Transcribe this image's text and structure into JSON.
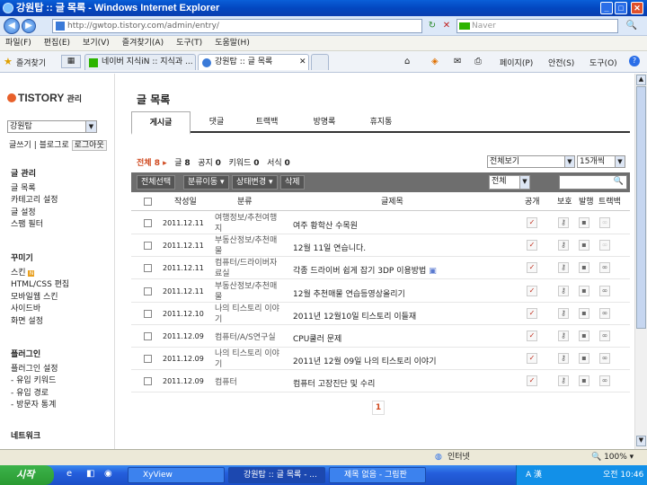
{
  "window": {
    "title": "강원탑 :: 글 목록 - Windows Internet Explorer",
    "min": "_",
    "max": "□",
    "close": "✕"
  },
  "address": {
    "url": "http://gwtop.tistory.com/admin/entry/",
    "search_placeholder": "Naver",
    "back": "◀",
    "forward": "▶",
    "refresh": "↻",
    "stop": "✕",
    "search_btn": "🔍"
  },
  "menu": [
    "파일(F)",
    "편집(E)",
    "보기(V)",
    "즐겨찾기(A)",
    "도구(T)",
    "도움말(H)"
  ],
  "favbar": {
    "favorites": "즐겨찾기",
    "tabs": [
      "네이버 지식iN :: 지식과 ...",
      "강원탑 :: 글 목록"
    ],
    "tools": [
      "페이지(P)",
      "안전(S)",
      "도구(O)"
    ]
  },
  "sidebar": {
    "logo": "TISTORY",
    "logo_suffix": "관리",
    "blog": "강원탑",
    "links": [
      "글쓰기",
      "블로그로",
      "로그아웃"
    ],
    "sections": [
      {
        "title": "글 관리",
        "items": [
          "글 목록",
          "카테고리 설정",
          "글 설정",
          "스팸 필터"
        ]
      },
      {
        "title": "꾸미기",
        "items": [
          "스킨",
          "HTML/CSS 편집",
          "모바일웹 스킨",
          "사이드바",
          "화면 설정"
        ]
      },
      {
        "title": "플러그인",
        "items": [
          "플러그인 설정",
          "- 유입 키워드",
          "- 유입 경로",
          "- 방문자 통계"
        ]
      },
      {
        "title": "네트워크",
        "items": []
      }
    ]
  },
  "main": {
    "title": "글 목록",
    "tabs": [
      "게시글",
      "댓글",
      "트랙백",
      "방명록",
      "휴지통"
    ],
    "counts": {
      "all_label": "전체",
      "all": "8",
      "post_label": "글",
      "post": "8",
      "notice_label": "공지",
      "notice": "0",
      "keyword_label": "키워드",
      "keyword": "0",
      "form_label": "서식",
      "form": "0"
    },
    "view_select": "전체보기",
    "per_page": "15개씩",
    "toolbar": {
      "select_all": "전체선택",
      "move": "분류이동",
      "status": "상태변경",
      "delete": "삭제",
      "filter": "전체"
    },
    "columns": {
      "date": "작성일",
      "category": "분류",
      "title": "글제목",
      "public": "공개",
      "protect": "보호",
      "publish": "발행",
      "trackback": "트랙백"
    },
    "rows": [
      {
        "date": "2011.12.11",
        "cat1": "여행정보/추천여행",
        "cat2": "지",
        "title": "여주 황학산 수목원"
      },
      {
        "date": "2011.12.11",
        "cat1": "부동산정보/추천매",
        "cat2": "물",
        "title": "12월 11일 연습니다."
      },
      {
        "date": "2011.12.11",
        "cat1": "컴퓨터/드라이버자",
        "cat2": "료실",
        "title": "각종 드라이버 쉽게 잡기 3DP 이용방법"
      },
      {
        "date": "2011.12.11",
        "cat1": "부동산정보/추천매",
        "cat2": "물",
        "title": "12월 추천매물 연습등영상올리기"
      },
      {
        "date": "2011.12.10",
        "cat1": "나의 티스토리 이야",
        "cat2": "기",
        "title": "2011년 12월10일 티스토리 이들재"
      },
      {
        "date": "2011.12.09",
        "cat1": "컴퓨터/A/S연구실",
        "cat2": "",
        "title": "CPU쿨러 문제"
      },
      {
        "date": "2011.12.09",
        "cat1": "나의 티스토리 이야",
        "cat2": "기",
        "title": "2011년 12월 09일 나의 티스토리 이야기"
      },
      {
        "date": "2011.12.09",
        "cat1": "컴퓨터",
        "cat2": "",
        "title": "컴퓨터 고장진단 및 수리"
      }
    ],
    "page": "1"
  },
  "status": {
    "zone": "인터넷",
    "zoom": "100%"
  },
  "taskbar": {
    "start": "시작",
    "items": [
      "XyView",
      "강원탑 :: 글 목록 - ...",
      "제목 없음 - 그림판"
    ],
    "clock": "오전 10:46",
    "ime": "A 漢"
  }
}
